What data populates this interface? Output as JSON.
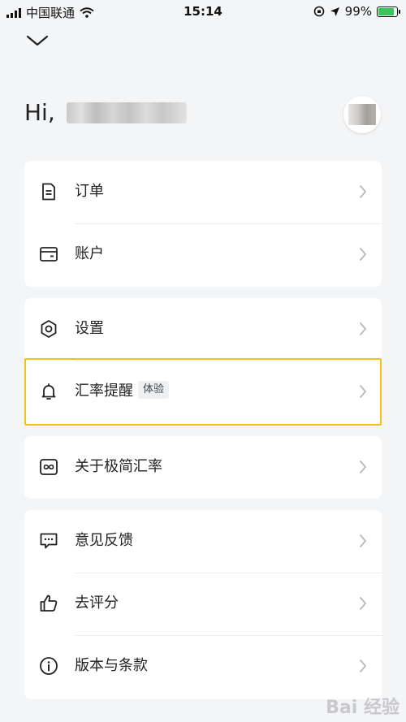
{
  "status_bar": {
    "carrier": "中国联通",
    "time": "15:14",
    "battery": "99%"
  },
  "greeting": "Hi,",
  "menu": {
    "orders": "订单",
    "account": "账户",
    "settings": "设置",
    "rate_alert": "汇率提醒",
    "rate_alert_badge": "体验",
    "about": "关于极简汇率",
    "feedback": "意见反馈",
    "rate_us": "去评分",
    "version_terms": "版本与条款"
  },
  "watermark": "Bai 经验",
  "colors": {
    "background": "#f4f5f7",
    "card": "#ffffff",
    "highlight_border": "#f2c21b",
    "battery_fill": "#34c759"
  }
}
